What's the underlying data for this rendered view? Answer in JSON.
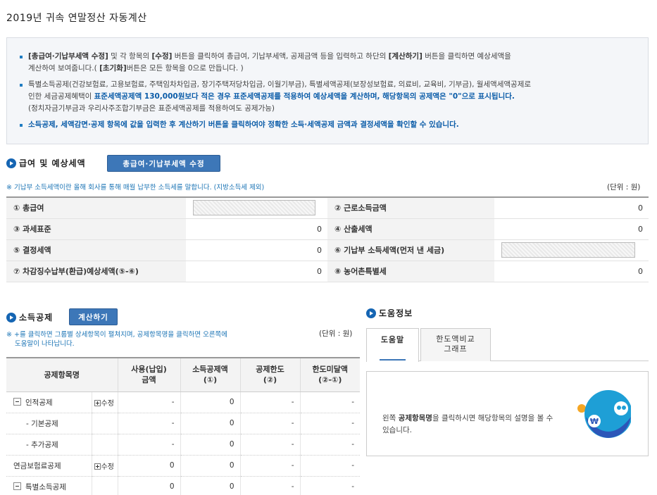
{
  "page": {
    "title": "2019년 귀속 연말정산 자동계산"
  },
  "notice": {
    "line1_a": "[총급여·기납부세액 수정]",
    "line1_b": " 및 각 항목의 ",
    "line1_c": "[수정]",
    "line1_d": " 버튼을 클릭하여 총급여, 기납부세액, 공제금액 등을 입력하고 하단의 ",
    "line1_e": "[계산하기]",
    "line1_f": " 버튼을 클릭하면 예상세액을",
    "line2_a": "계산하여 보여줍니다.( ",
    "line2_b": "[초기화]",
    "line2_c": "버튼은 모든 항목을 0으로 만듭니다. )",
    "line3": "특별소득공제(건강보험료, 고용보험료, 주택임차차입금, 장기주택저당차입금, 이월기부금), 특별세액공제(보장성보험료, 의료비, 교육비, 기부금), 월세액세액공제로",
    "line4_a": "인한 세금공제혜택이 ",
    "line4_b": "표준세액공제액 130,000원보다 적은 경우 표준세액공제를 적용하여 예상세액을 계산하며, 해당항목의 공제액은 \"0\"으로 표시됩니다.",
    "line5": "(정치자금기부금과 우리사주조합기부금은 표준세액공제를 적용하여도 공제가능)",
    "line6": "소득공제, 세액감면·공제 항목에 값을 입력한 후 계산하기 버튼을 클릭하여야 정확한 소득·세액공제 금액과 결정세액을 확인할 수 있습니다."
  },
  "salary": {
    "title": "급여 및 예상세액",
    "edit_button": "총급여·기납부세액 수정",
    "note": "※ 기납부 소득세액이란 올해 회사를 통해 매월 납부한 소득세를 말합니다. (지방소득세 제외)",
    "unit": "(단위 : 원)",
    "rows": [
      {
        "l1": "① 총급여",
        "v1": "",
        "l2": "② 근로소득금액",
        "v2": "0"
      },
      {
        "l1": "③ 과세표준",
        "v1": "0",
        "l2": "④ 산출세액",
        "v2": "0"
      },
      {
        "l1": "⑤ 결정세액",
        "v1": "0",
        "l2": "⑥ 기납부 소득세액(먼저 낸 세금)",
        "v2": ""
      },
      {
        "l1": "⑦ 차감징수납부(환급)예상세액(⑤-⑥)",
        "v1": "0",
        "l2": "⑧ 농어촌특별세",
        "v2": "0"
      }
    ]
  },
  "deduction": {
    "title": "소득공제",
    "calc_button": "계산하기",
    "note_line1": "※ +를 클릭하면 그룹별 상세항목이 펼쳐지며, 공제항목명을 클릭하면 오른쪽에",
    "note_line2": "도움말이 나타납니다.",
    "unit": "(단위 : 원)",
    "headers": {
      "name": "공제항목명",
      "paid_1": "사용(납입)",
      "paid_2": "금액",
      "amount_1": "소득공제액",
      "amount_2": "(①)",
      "limit_1": "공제한도",
      "limit_2": "(②)",
      "remain_1": "한도미달액",
      "remain_2": "(②-①)"
    },
    "edit_label": "수정",
    "rows": [
      {
        "name": "인적공제",
        "paid": "-",
        "amount": "0",
        "limit": "-",
        "remain": "-"
      },
      {
        "name": "- 기본공제",
        "paid": "-",
        "amount": "0",
        "limit": "-",
        "remain": "-"
      },
      {
        "name": "- 추가공제",
        "paid": "-",
        "amount": "0",
        "limit": "-",
        "remain": "-"
      },
      {
        "name": "연금보험료공제",
        "paid": "0",
        "amount": "0",
        "limit": "-",
        "remain": "-"
      },
      {
        "name": "특별소득공제",
        "paid": "0",
        "amount": "0",
        "limit": "-",
        "remain": "-"
      }
    ]
  },
  "help": {
    "title": "도움정보",
    "tab_help": "도움말",
    "tab_graph_1": "한도액비교",
    "tab_graph_2": "그래프",
    "text_a": "왼쪽 ",
    "text_b": "공제항목명",
    "text_c": "을 클릭하시면 해당항목의 설명을 볼 수 있습니다.",
    "mascot_mark": "₩"
  },
  "colors": {
    "accent": "#1565b3",
    "button": "#3d77b8",
    "note_blue": "#1b74b5",
    "highlight_blue": "#0b5ca8"
  }
}
